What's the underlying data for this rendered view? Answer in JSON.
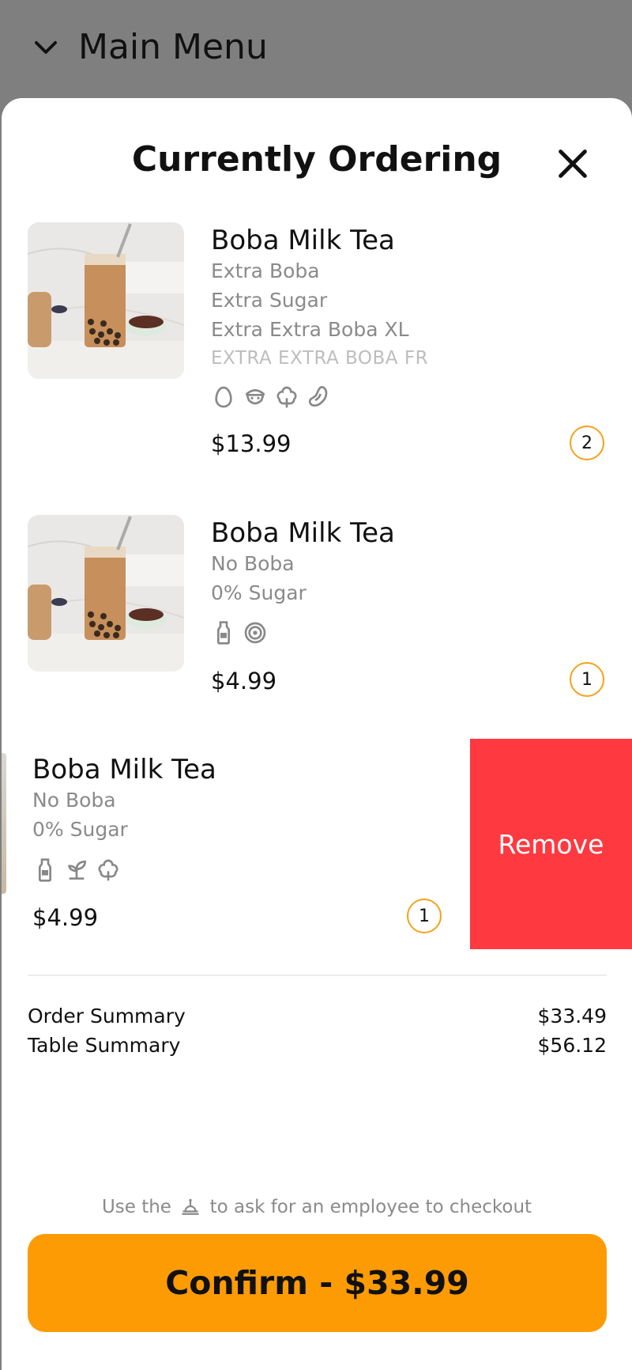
{
  "topbar": {
    "title": "Main Menu",
    "icon": "chevron-down-icon"
  },
  "sheet": {
    "title": "Currently Ordering",
    "close_icon": "close-icon"
  },
  "items": [
    {
      "name": "Boba Milk Tea",
      "options": [
        "Extra Boba",
        "Extra Sugar",
        "Extra Extra Boba XL",
        "EXTRA EXTRA BOBA FR"
      ],
      "icons": [
        "egg-icon",
        "shellfish-icon",
        "tree-nut-icon",
        "bean-icon"
      ],
      "price": "$13.99",
      "quantity": "2"
    },
    {
      "name": "Boba Milk Tea",
      "options": [
        "No Boba",
        "0% Sugar"
      ],
      "icons": [
        "milk-bottle-icon",
        "swirl-icon"
      ],
      "price": "$4.99",
      "quantity": "1"
    },
    {
      "name": "Boba Milk Tea",
      "options": [
        "No Boba",
        "0% Sugar"
      ],
      "icons": [
        "milk-bottle-icon",
        "sprout-icon",
        "tree-nut-icon"
      ],
      "price": "$4.99",
      "quantity": "1",
      "action_label": "Remove"
    }
  ],
  "summary": {
    "order_label": "Order Summary",
    "order_value": "$33.49",
    "table_label": "Table Summary",
    "table_value": "$56.12"
  },
  "hint": {
    "before": "Use the",
    "after": "to ask for an employee to checkout",
    "icon": "bell-icon"
  },
  "confirm_label": "Confirm - $33.99",
  "colors": {
    "accent": "#fd9b05",
    "remove": "#fe3940",
    "qty_ring": "#f7a21b"
  }
}
